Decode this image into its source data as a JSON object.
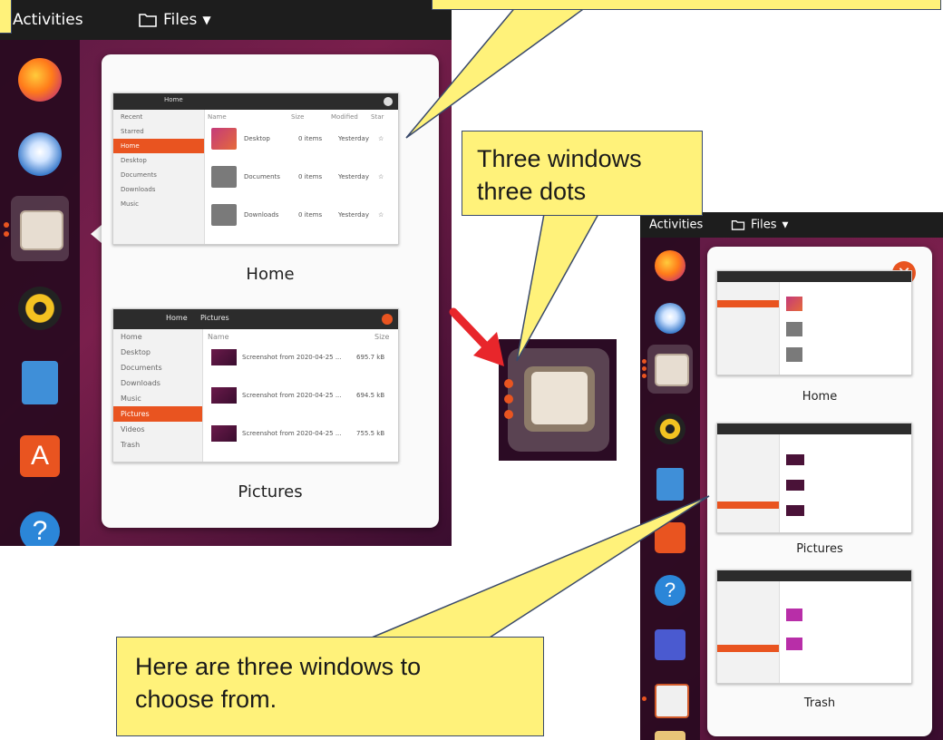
{
  "left_panel": {
    "topbar": {
      "activities": "Activities",
      "app_menu": "Files"
    },
    "windows": [
      {
        "label": "Home",
        "thumb": {
          "path": "Home",
          "sidebar": [
            "Recent",
            "Starred",
            "Home",
            "Desktop",
            "Documents",
            "Downloads",
            "Music"
          ],
          "selected": "Home",
          "headers": [
            "Name",
            "Size",
            "Modified",
            "Star"
          ],
          "rows": [
            {
              "name": "Desktop",
              "size": "0 items",
              "modified": "Yesterday"
            },
            {
              "name": "Documents",
              "size": "0 items",
              "modified": "Yesterday"
            },
            {
              "name": "Downloads",
              "size": "0 items",
              "modified": "Yesterday"
            }
          ]
        }
      },
      {
        "label": "Pictures",
        "thumb": {
          "path_home": "Home",
          "path": "Pictures",
          "sidebar": [
            "Home",
            "Desktop",
            "Documents",
            "Downloads",
            "Music",
            "Pictures",
            "Videos",
            "Trash"
          ],
          "selected": "Pictures",
          "headers": [
            "Name",
            "Size"
          ],
          "rows": [
            {
              "name": "Screenshot from 2020-04-25 ...",
              "size": "695.7 kB"
            },
            {
              "name": "Screenshot from 2020-04-25 ...",
              "size": "694.5 kB"
            },
            {
              "name": "Screenshot from 2020-04-25 ...",
              "size": "755.5 kB"
            }
          ]
        }
      }
    ]
  },
  "right_panel": {
    "topbar": {
      "activities": "Activities",
      "app_menu": "Files"
    },
    "windows": [
      {
        "label": "Home"
      },
      {
        "label": "Pictures"
      },
      {
        "label": "Trash"
      }
    ]
  },
  "callouts": {
    "three_dots": "Three windows three dots",
    "choose": "Here are three windows to choose from."
  },
  "colors": {
    "accent": "#e95420",
    "callout": "#fff27a",
    "arrow": "#e8262b"
  }
}
